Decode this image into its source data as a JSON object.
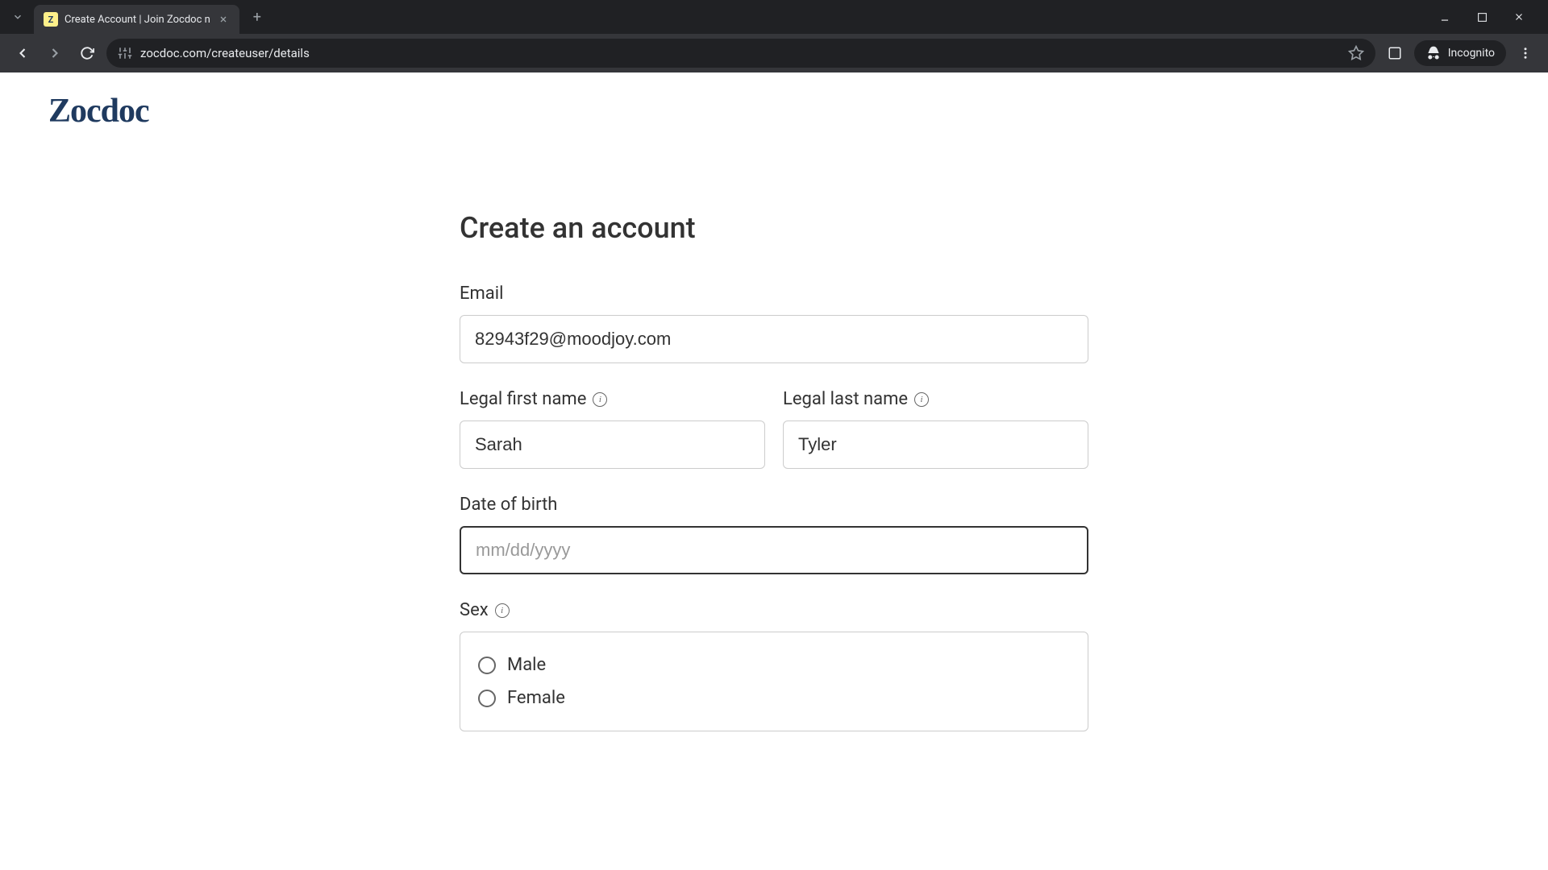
{
  "browser": {
    "tab_title": "Create Account | Join Zocdoc n",
    "url": "zocdoc.com/createuser/details",
    "incognito_label": "Incognito"
  },
  "page": {
    "logo": "Zocdoc",
    "title": "Create an account",
    "email_label": "Email",
    "email_value": "82943f29@moodjoy.com",
    "first_name_label": "Legal first name",
    "first_name_value": "Sarah",
    "last_name_label": "Legal last name",
    "last_name_value": "Tyler",
    "dob_label": "Date of birth",
    "dob_placeholder": "mm/dd/yyyy",
    "dob_value": "",
    "sex_label": "Sex",
    "sex_options": {
      "male": "Male",
      "female": "Female"
    }
  }
}
